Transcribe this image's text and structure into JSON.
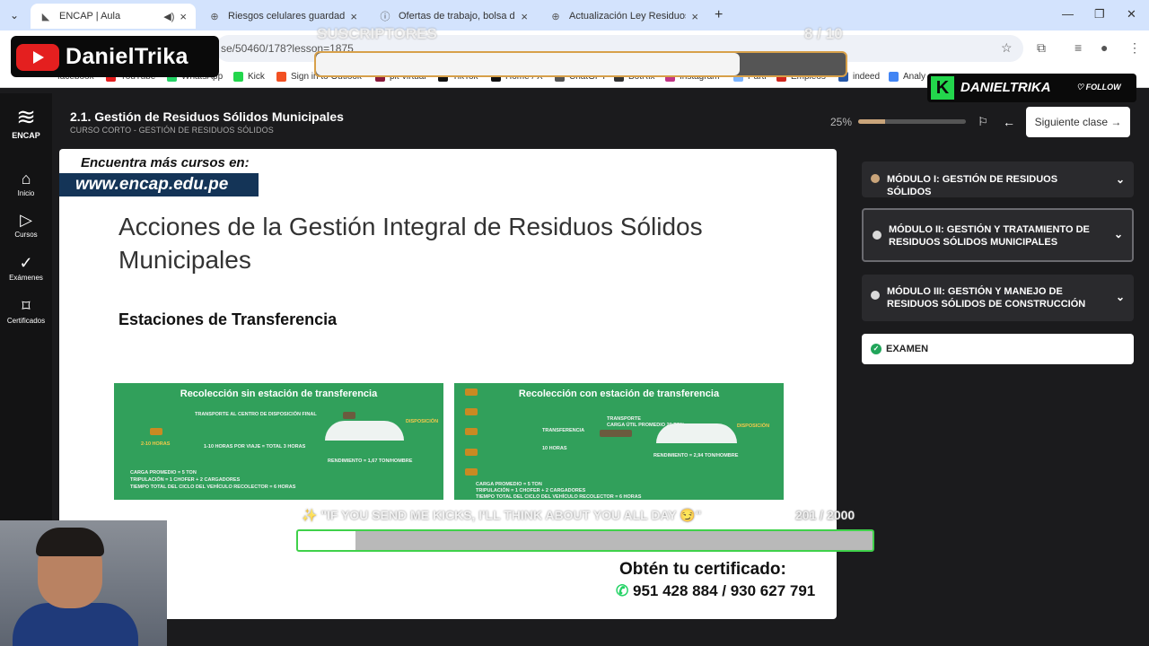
{
  "browser": {
    "tabs": [
      {
        "label": "ENCAP | Aula",
        "active": true,
        "favicon": "encap-icon"
      },
      {
        "label": "Riesgos celulares guardados",
        "active": false,
        "favicon": "globe-icon"
      },
      {
        "label": "Ofertas de trabajo, bolsa de tra",
        "active": false,
        "favicon": "info-icon"
      },
      {
        "label": "Actualización Ley Residuos",
        "active": false,
        "favicon": "globe-icon"
      }
    ],
    "address": "se/50460/178?lesson=1875",
    "bookmarks": [
      "facebook",
      "YouTube",
      "WhatsApp",
      "Kick",
      "Sign in to Outlook",
      "pit-virtual",
      "TikTok",
      "Home / X",
      "ChatGPT",
      "BotRix",
      "Instagram",
      "Parti",
      "Empleos",
      "indeed",
      "Analy"
    ]
  },
  "overlay": {
    "channel_name": "DanielTrika",
    "subs_label": "SUSCRIPTORES",
    "subs_count": "8 / 10",
    "subs_progress": 0.8,
    "kick_name": "DANIELTRIKA",
    "follow_label": "FOLLOW",
    "kick_goal_text": "✨ \"IF YOU SEND ME KICKS, I'LL THINK ABOUT YOU ALL DAY 😏\"",
    "kick_count": "201",
    "kick_target": "/ 2000",
    "kick_progress": 0.1
  },
  "sidebar_nav": {
    "logo_label": "ENCAP",
    "items": [
      {
        "label": "Inicio",
        "icon": "home-icon"
      },
      {
        "label": "Cursos",
        "icon": "play-icon"
      },
      {
        "label": "Exámenes",
        "icon": "check-icon"
      },
      {
        "label": "Certificados",
        "icon": "bookmark-icon"
      }
    ]
  },
  "header": {
    "lesson_title": "2.1. Gestión de Residuos Sólidos Municipales",
    "course_subtitle": "CURSO CORTO - GESTIÓN DE RESIDUOS SÓLIDOS",
    "progress_label": "25%",
    "progress_value": 0.25,
    "next_label": "Siguiente clase"
  },
  "slide": {
    "promo_line1": "Encuentra más cursos en:",
    "promo_line2": "www.encap.edu.pe",
    "title": "Acciones de la Gestión Integral de Residuos Sólidos Municipales",
    "subtitle": "Estaciones de Transferencia",
    "diagram_left": {
      "title": "Recolección sin estación de transferencia",
      "lines": [
        "TRANSPORTE AL CENTRO DE DISPOSICIÓN FINAL",
        "2-10 HORAS",
        "1-10 HORAS POR VIAJE = TOTAL 3 HORAS",
        "DISPOSICIÓN",
        "RENDIMIENTO = 1,67 TON/HOMBRE",
        "CARGA PROMEDIO = 5 TON",
        "TRIPULACIÓN = 1 CHOFER + 2 CARGADORES",
        "TIEMPO TOTAL DEL CICLO DEL VEHÍCULO RECOLECTOR = 6 HORAS"
      ]
    },
    "diagram_right": {
      "title": "Recolección con estación de transferencia",
      "lines": [
        "TRANSPORTE",
        "CARGA ÚTIL PROMEDIO 20 TON",
        "TRANSFERENCIA",
        "DISPOSICIÓN",
        "10 HORAS",
        "RENDIMIENTO = 2,94 TON/HOMBRE",
        "CARGA PROMEDIO = 5 TON",
        "TRIPULACIÓN = 1 CHOFER + 2 CARGADORES",
        "TIEMPO TOTAL DEL CICLO DEL VEHÍCULO RECOLECTOR = 6 HORAS"
      ]
    },
    "cert_label": "Obtén tu certificado:",
    "phones": "951 428 884 / 930 627 791"
  },
  "modules": [
    {
      "label": "MÓDULO I: GESTIÓN DE RESIDUOS SÓLIDOS",
      "status": "done"
    },
    {
      "label": "MÓDULO II: GESTIÓN Y TRATAMIENTO DE RESIDUOS SÓLIDOS MUNICIPALES",
      "status": "pending",
      "selected": true
    },
    {
      "label": "MÓDULO III: GESTIÓN Y MANEJO DE RESIDUOS SÓLIDOS DE CONSTRUCCIÓN",
      "status": "pending"
    }
  ],
  "exam_label": "EXAMEN",
  "colors": {
    "accent": "#c9a47a",
    "kick_green": "#23d64c",
    "youtube_red": "#e41f1f",
    "diagram_green": "#31a05b",
    "promo_blue": "#143457"
  }
}
